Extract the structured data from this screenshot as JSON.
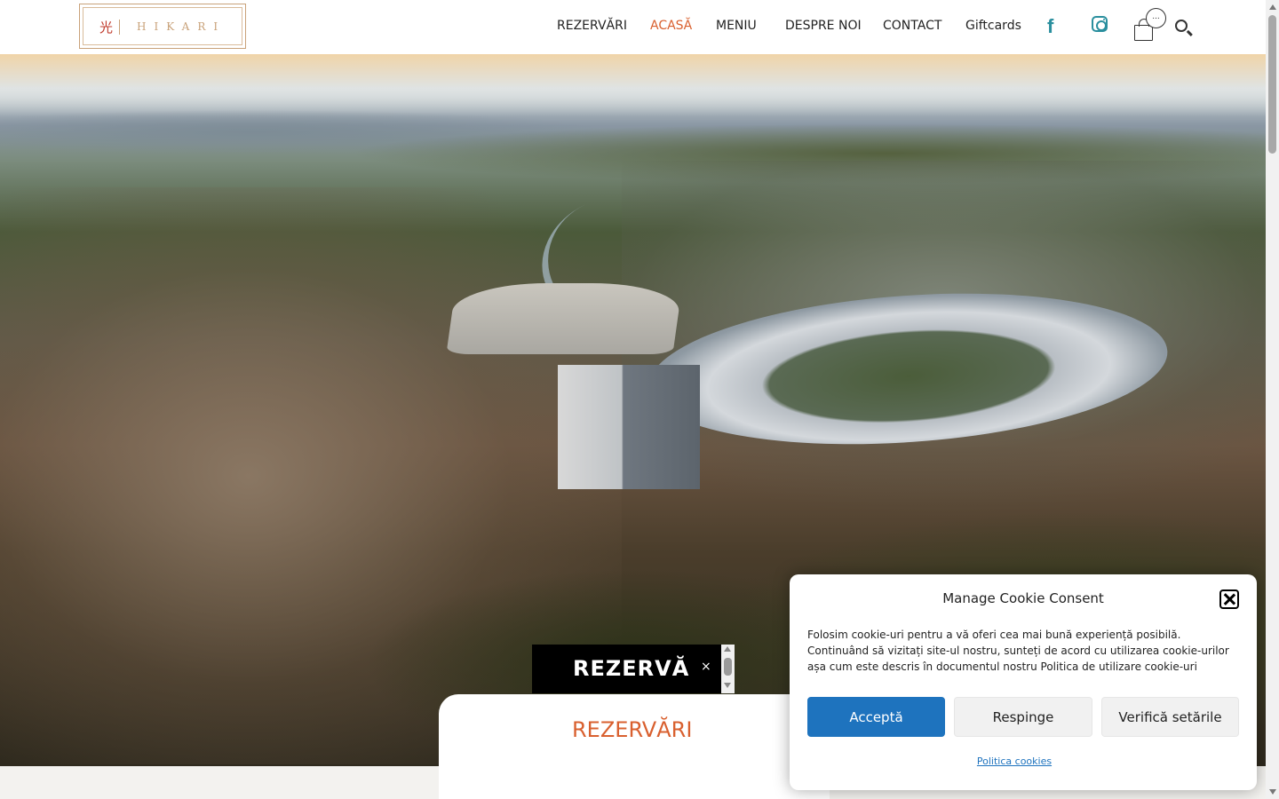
{
  "logo": {
    "mark": "光",
    "text": "HIKARI"
  },
  "nav": {
    "items": [
      {
        "label": "REZERVĂRI",
        "active": false
      },
      {
        "label": "ACASĂ",
        "active": true
      },
      {
        "label": "MENIU",
        "active": false
      },
      {
        "label": "DESPRE NOI",
        "active": false
      },
      {
        "label": "CONTACT",
        "active": false
      },
      {
        "label": "Giftcards",
        "active": false
      }
    ]
  },
  "header_icons": {
    "facebook": "facebook-icon",
    "instagram": "instagram-icon",
    "cart": "shopping-bag-icon",
    "cart_badge": "...",
    "search": "search-icon"
  },
  "reserve_widget": {
    "label": "REZERVĂ",
    "close": "×"
  },
  "reserve_card": {
    "title": "REZERVĂRI"
  },
  "cookie": {
    "title": "Manage Cookie Consent",
    "text": "Folosim cookie-uri pentru a vă oferi cea mai bună experiență posibilă. Continuând să vizitați site-ul nostru, sunteți de acord cu utilizarea cookie-urilor așa cum este descris în documentul nostru Politica de utilizare cookie-uri",
    "accept": "Acceptă",
    "deny": "Respinge",
    "settings": "Verifică setările",
    "policy_link": "Politica cookies"
  },
  "colors": {
    "accent": "#d9602f",
    "social": "#2a8f9e",
    "primary_button": "#1e73be",
    "logo_gold": "#c9a27a"
  }
}
